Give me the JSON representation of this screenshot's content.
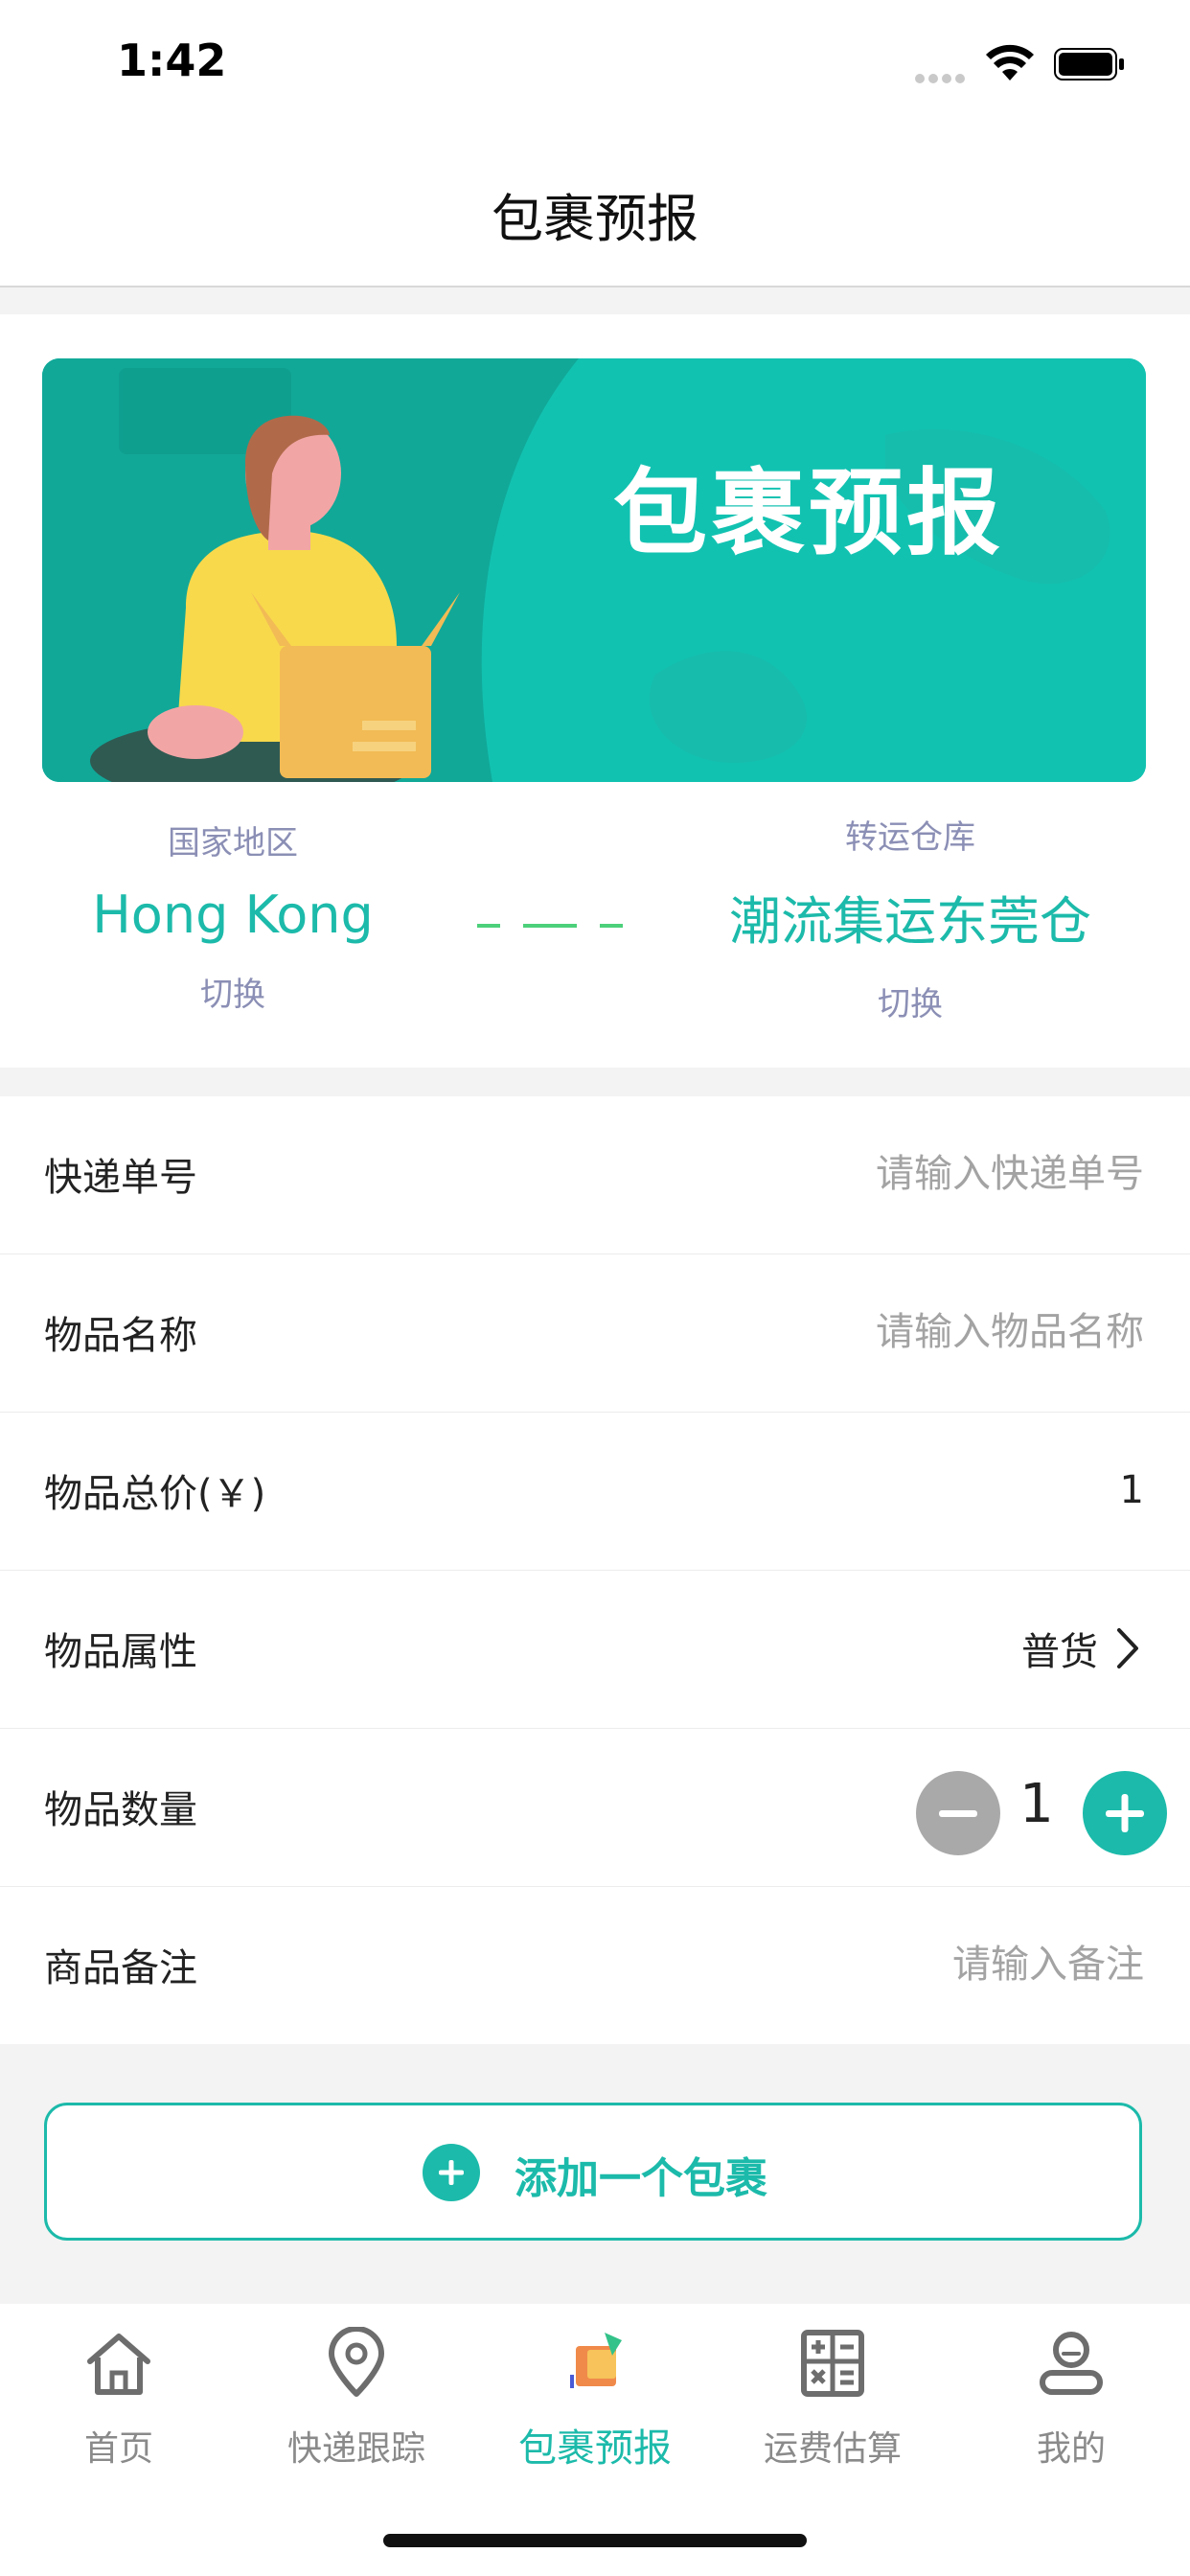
{
  "status_bar": {
    "time": "1:42"
  },
  "nav": {
    "title": "包裹预报"
  },
  "banner": {
    "title": "包裹预报"
  },
  "route": {
    "origin_label": "国家地区",
    "origin_value": "Hong Kong",
    "origin_switch": "切换",
    "warehouse_label": "转运仓库",
    "warehouse_value": "潮流集运东莞仓",
    "warehouse_switch": "切换"
  },
  "form": {
    "tracking": {
      "label": "快递单号",
      "placeholder": "请输入快递单号",
      "value": ""
    },
    "item_name": {
      "label": "物品名称",
      "placeholder": "请输入物品名称",
      "value": ""
    },
    "total_price": {
      "label": "物品总价(￥)",
      "placeholder": "",
      "value": "1"
    },
    "attribute": {
      "label": "物品属性",
      "value": "普货"
    },
    "quantity": {
      "label": "物品数量",
      "value": "1"
    },
    "remark": {
      "label": "商品备注",
      "placeholder": "请输入备注",
      "value": ""
    }
  },
  "add_button": {
    "label": "添加一个包裹"
  },
  "tabs": [
    {
      "label": "首页",
      "icon": "home-icon"
    },
    {
      "label": "快递跟踪",
      "icon": "location-pin-icon"
    },
    {
      "label": "包裹预报",
      "icon": "parcel-forecast-icon",
      "active": true
    },
    {
      "label": "运费估算",
      "icon": "calculator-icon"
    },
    {
      "label": "我的",
      "icon": "profile-icon"
    }
  ],
  "colors": {
    "accent": "#1cbaaa",
    "banner": "#12c2b1",
    "muted_label": "#8b8fb5",
    "route_line": "#4cd07a"
  }
}
